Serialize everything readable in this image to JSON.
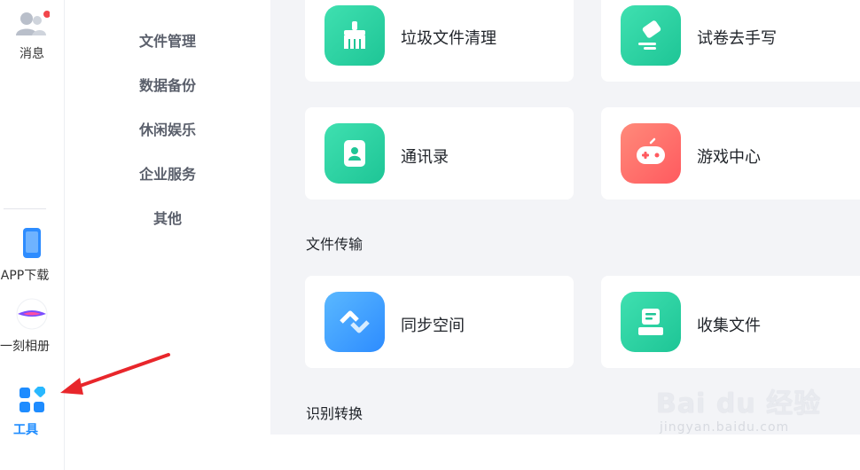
{
  "rail": {
    "messages_label": "消息",
    "app_download_label": "APP下载",
    "album_label": "一刻相册",
    "tools_label": "工具"
  },
  "categories": [
    "文件管理",
    "数据备份",
    "休闲娱乐",
    "企业服务",
    "其他"
  ],
  "cards": {
    "trash_clean": "垃圾文件清理",
    "exam_erase": "试卷去手写",
    "contacts": "通讯录",
    "game_center": "游戏中心",
    "sync_space": "同步空间",
    "collect_files": "收集文件"
  },
  "sections": {
    "file_transfer": "文件传输",
    "recognize_convert": "识别转换"
  },
  "watermark": {
    "brand": "Bai du 经验",
    "url": "jingyan.baidu.com"
  },
  "colors": {
    "green_tile": "#1ec596",
    "red_tile": "#ff5a5f",
    "blue_tile": "#2d8cff",
    "tool_accent": "#1e8cff",
    "arrow": "#e8262b"
  }
}
